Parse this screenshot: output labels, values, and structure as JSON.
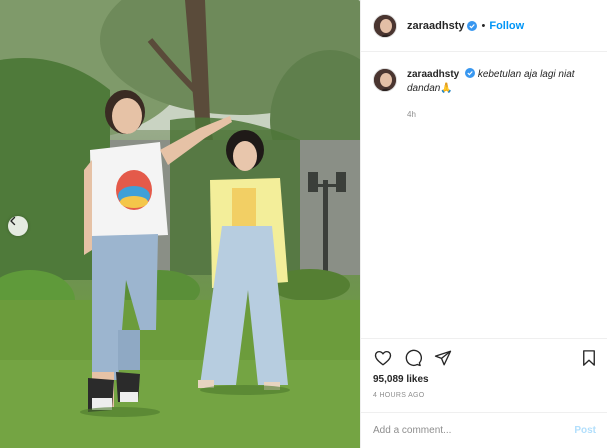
{
  "post": {
    "username": "zaraadhsty",
    "verified": true,
    "separator": "•",
    "follow_label": "Follow",
    "caption": "kebetulan aja lagi niat dandan",
    "caption_emoji": "🙏",
    "caption_timeago": "4h",
    "likes": "95,089 likes",
    "posted_time": "4 HOURS AGO",
    "comment_placeholder": "Add a comment...",
    "post_label": "Post"
  },
  "icons": {
    "like": "heart-icon",
    "comment": "comment-icon",
    "share": "paper-plane-icon",
    "save": "bookmark-icon",
    "verified": "verified-badge-icon",
    "carousel_prev": "chevron-left-icon"
  },
  "colors": {
    "link_blue": "#0095f6",
    "verified_blue": "#3897f0",
    "border": "#efefef",
    "muted": "#8e8e8e",
    "post_disabled": "#b2dffc"
  }
}
